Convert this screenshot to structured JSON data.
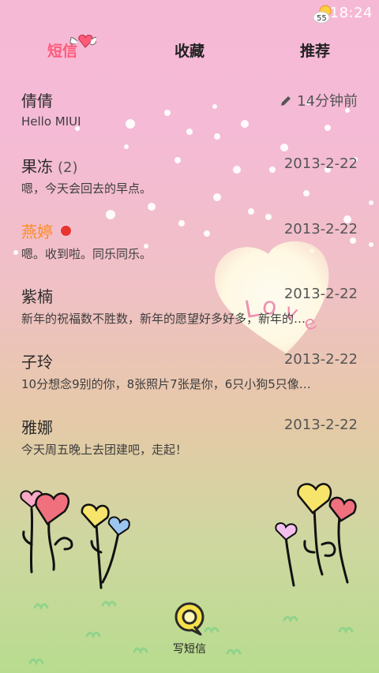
{
  "status_bar": {
    "weather_temp": "55",
    "time": "18:24"
  },
  "tabs": [
    {
      "label": "短信",
      "active": true
    },
    {
      "label": "收藏",
      "active": false
    },
    {
      "label": "推荐",
      "active": false
    }
  ],
  "threads": [
    {
      "name": "倩倩",
      "count": "",
      "unread": false,
      "draft": true,
      "time": "14分钟前",
      "preview": "Hello MIUI"
    },
    {
      "name": "果冻",
      "count": "(2)",
      "unread": false,
      "draft": false,
      "time": "2013-2-22",
      "preview": "嗯，今天会回去的早点。"
    },
    {
      "name": "燕婷",
      "count": "",
      "unread": true,
      "draft": false,
      "time": "2013-2-22",
      "preview": "嗯。收到啦。同乐同乐。"
    },
    {
      "name": "紫楠",
      "count": "",
      "unread": false,
      "draft": false,
      "time": "2013-2-22",
      "preview": "新年的祝福数不胜数，新年的愿望好多好多，新年的…"
    },
    {
      "name": "子玲",
      "count": "",
      "unread": false,
      "draft": false,
      "time": "2013-2-22",
      "preview": "10分想念9别的你，8张照片7张是你，6只小狗5只像…"
    },
    {
      "name": "雅娜",
      "count": "",
      "unread": false,
      "draft": false,
      "time": "2013-2-22",
      "preview": "今天周五晚上去团建吧，走起！"
    }
  ],
  "compose": {
    "label": "写短信"
  },
  "decor": {
    "heart_text": "Love"
  },
  "colors": {
    "accent": "#ff5a7a",
    "unread_name": "#ff8a1e",
    "badge": "#e8352f"
  },
  "icons": [
    "weather-icon",
    "pencil-icon",
    "compose-icon",
    "heart-icon"
  ]
}
